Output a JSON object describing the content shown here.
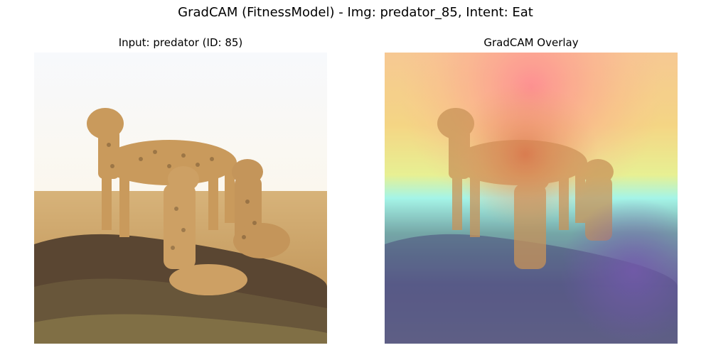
{
  "figure": {
    "suptitle": "GradCAM (FitnessModel) - Img: predator_85, Intent: Eat"
  },
  "panels": [
    {
      "title": "Input: predator (ID: 85)"
    },
    {
      "title": "GradCAM Overlay"
    }
  ],
  "colors": {
    "sky": "#f4f7fb",
    "grass": "#c99a5a",
    "mound": "#4a3a2a",
    "cheetah": "#c89a5c",
    "heat_hot": "#ff6a6a",
    "heat_warm": "#f7e07a",
    "heat_mid": "#9ef0e0",
    "heat_cool": "#5a5ab0"
  }
}
